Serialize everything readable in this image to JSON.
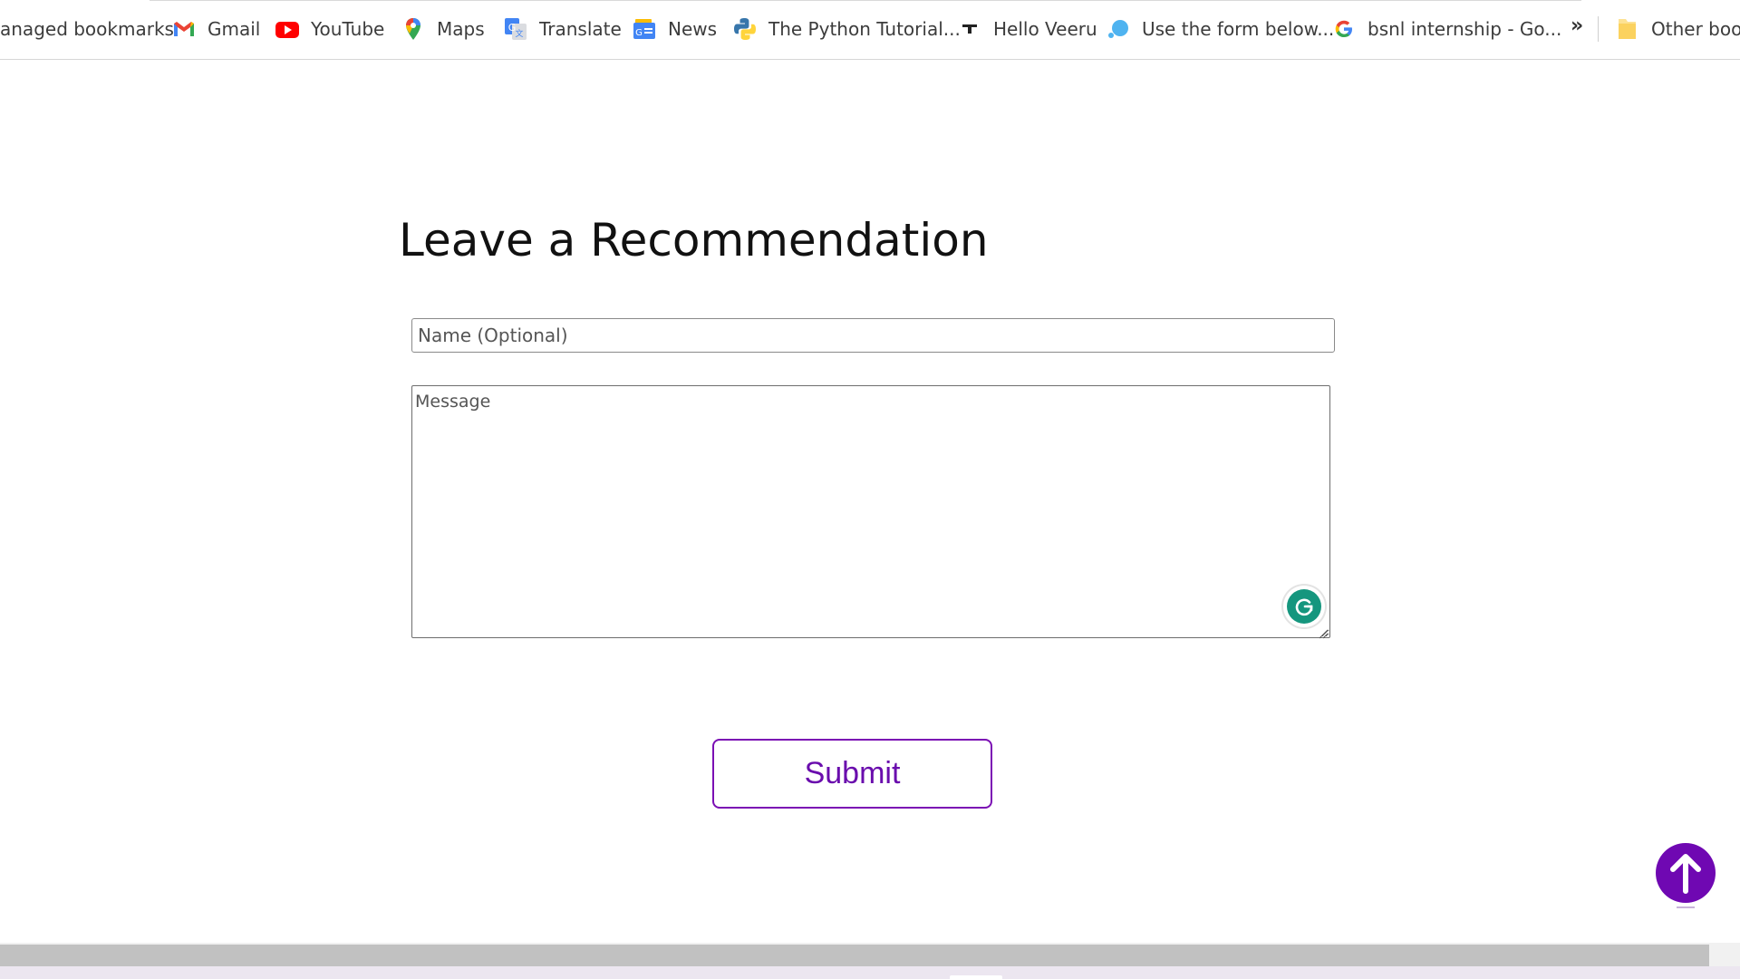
{
  "bookmarks_bar": {
    "items": [
      {
        "label": "anaged bookmarks",
        "icon": "none"
      },
      {
        "label": "Gmail",
        "icon": "gmail-icon"
      },
      {
        "label": "YouTube",
        "icon": "youtube-icon"
      },
      {
        "label": "Maps",
        "icon": "maps-pin-icon"
      },
      {
        "label": "Translate",
        "icon": "google-translate-icon"
      },
      {
        "label": "News",
        "icon": "google-news-icon"
      },
      {
        "label": "The Python Tutorial...",
        "icon": "python-icon"
      },
      {
        "label": "Hello Veeru",
        "icon": "site-favicon-icon"
      },
      {
        "label": "Use the form below...",
        "icon": "blue-bubble-icon"
      },
      {
        "label": "bsnl internship - Go...",
        "icon": "google-g-icon"
      }
    ],
    "more_label": "»",
    "other_bookmarks_label": "Other book"
  },
  "form": {
    "title": "Leave a Recommendation",
    "name_placeholder": "Name (Optional)",
    "message_placeholder": "Message",
    "submit_label": "Submit"
  },
  "colors": {
    "accent": "#7b0fb4",
    "grammarly": "#15967e",
    "scroll_top_button": "#6f08b2"
  }
}
